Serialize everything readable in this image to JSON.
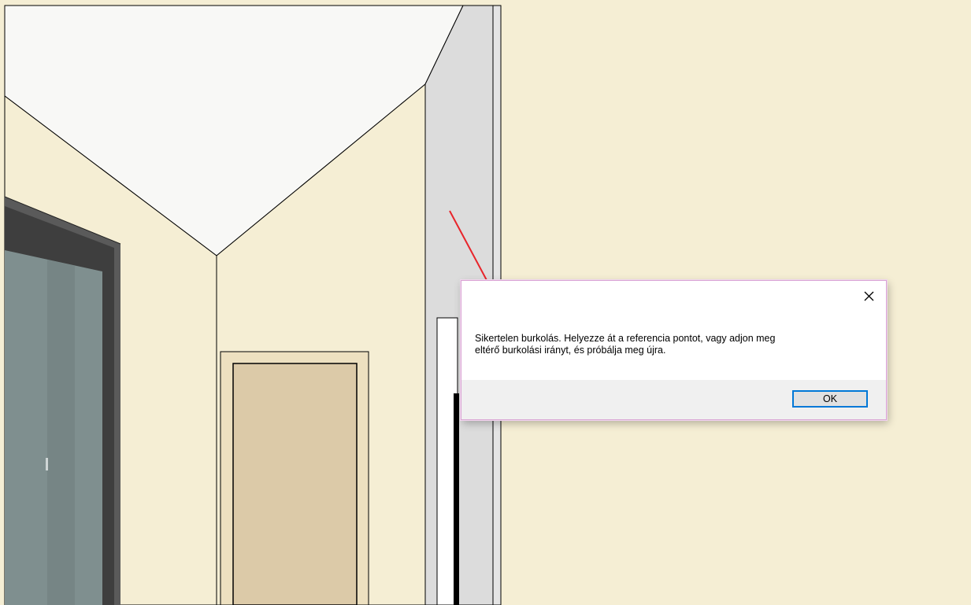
{
  "dialog": {
    "message": "Sikertelen burkolás. Helyezze át a referencia pontot, vagy adjon meg\neltérő burkolási irányt, és próbálja meg újra.",
    "ok_label": "OK",
    "close_icon": "close-icon"
  },
  "annotation": {
    "arrow_color": "#e8252b"
  },
  "colors": {
    "wall": "#f5eed4",
    "ceiling": "#f8f8f6",
    "door": "#dccaa8",
    "door_frame": "#ede0c0",
    "column": "#dcdcdc",
    "glass": "#7f8f8f"
  }
}
